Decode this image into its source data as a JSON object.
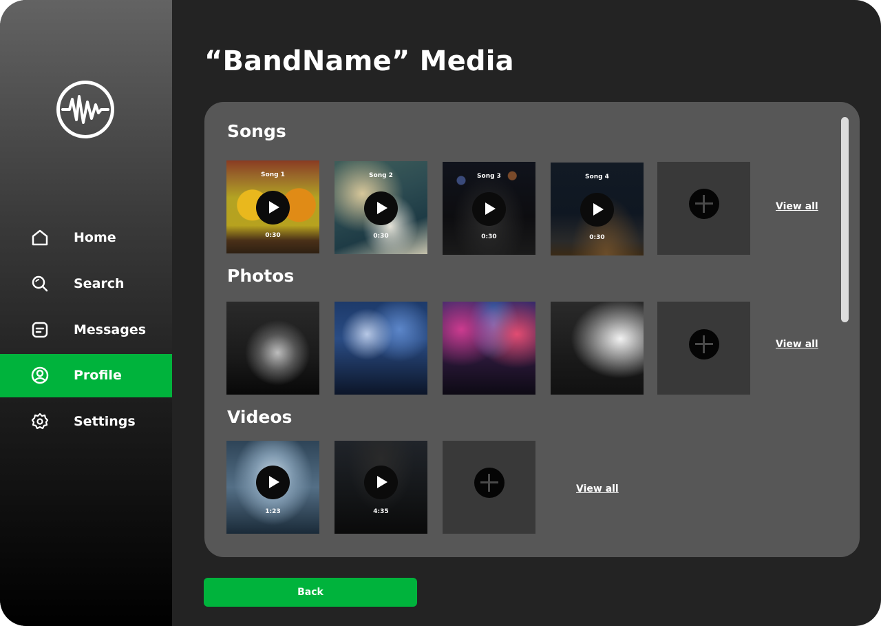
{
  "app": {
    "accent_color": "#00b33c"
  },
  "page": {
    "title": "“BandName” Media"
  },
  "sidebar": {
    "logo_icon": "waveform-icon",
    "items": [
      {
        "label": "Home",
        "icon": "home-icon",
        "active": false
      },
      {
        "label": "Search",
        "icon": "search-icon",
        "active": false
      },
      {
        "label": "Messages",
        "icon": "message-icon",
        "active": false
      },
      {
        "label": "Profile",
        "icon": "user-icon",
        "active": true
      },
      {
        "label": "Settings",
        "icon": "gear-icon",
        "active": false
      }
    ]
  },
  "sections": {
    "songs": {
      "title": "Songs",
      "items": [
        {
          "label": "Song 1",
          "duration": "0:30"
        },
        {
          "label": "Song 2",
          "duration": "0:30"
        },
        {
          "label": "Song 3",
          "duration": "0:30"
        },
        {
          "label": "Song 4",
          "duration": "0:30"
        }
      ],
      "add_icon": "plus-icon",
      "view_all": "View all"
    },
    "photos": {
      "title": "Photos",
      "count": 4,
      "add_icon": "plus-icon",
      "view_all": "View all"
    },
    "videos": {
      "title": "Videos",
      "items": [
        {
          "duration": "1:23"
        },
        {
          "duration": "4:35"
        }
      ],
      "add_icon": "plus-icon",
      "view_all": "View all"
    }
  },
  "footer": {
    "back_label": "Back"
  }
}
